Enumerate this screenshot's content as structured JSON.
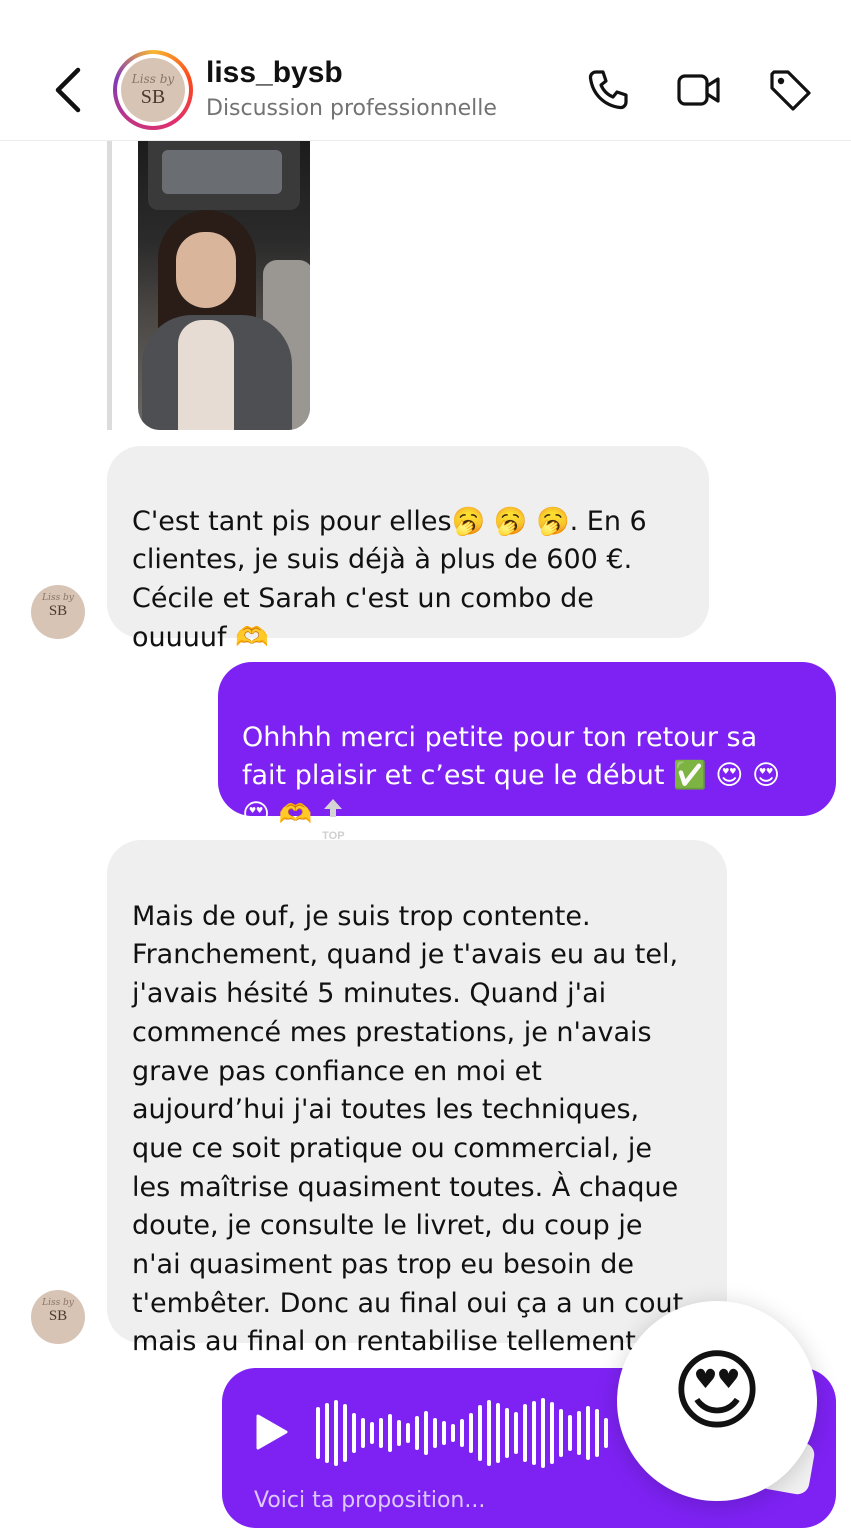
{
  "header": {
    "name": "liss_bysb",
    "subtitle": "Discussion professionnelle",
    "avatar_script": "Liss by",
    "avatar_initials": "SB"
  },
  "messages": [
    {
      "id": "msg1",
      "from": "liss_bysb",
      "line1_before": "C'est tant pis pour elles",
      "line1_emojis": "🥱 🥱 🥱",
      "line1_after": ". En 6",
      "rest": "clientes, je suis déjà à plus de 600 €.\nCécile et Sarah c'est un combo de\nouuuuf",
      "trailing_emoji": "🫶"
    },
    {
      "id": "msg2",
      "from": "me",
      "text": "Ohhhh merci petite pour ton retour sa\nfait plaisir et c’est que le début",
      "emojis_line1": "✅ 😍 😍",
      "emojis_line2": "😍 🫶",
      "top_badge": "TOP"
    },
    {
      "id": "msg3",
      "from": "liss_bysb",
      "text": "Mais de ouf, je suis trop contente.\nFranchement, quand je t'avais eu au tel,\nj'avais hésité 5 minutes. Quand j'ai\ncommencé mes prestations, je n'avais\ngrave pas confiance en moi et\naujourd’hui j'ai toutes les techniques,\nque ce soit pratique ou commercial, je\nles maîtrise quasiment toutes. À chaque\ndoute, je consulte le livret, du coup je\nn'ai quasiment pas trop eu besoin de\nt'embêter. Donc au final oui ça a un cout\nmais au final on rentabilise tellement",
      "trailing_emoji": "🥱"
    }
  ],
  "voice_message": {
    "caption": "Voici ta proposition..."
  },
  "reaction": {
    "emoji": "😍"
  },
  "colors": {
    "outgoing_bubble": "#7e22f4",
    "incoming_bubble": "#efefef",
    "subtitle_gray": "#737373"
  },
  "icons": [
    "back-arrow-icon",
    "phone-icon",
    "video-camera-icon",
    "tag-icon",
    "play-icon",
    "top-arrow-icon"
  ]
}
